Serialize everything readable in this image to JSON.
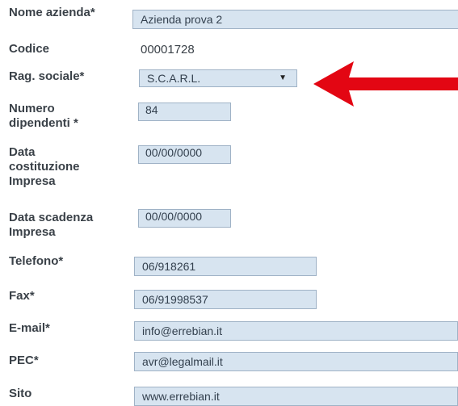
{
  "form": {
    "nome_azienda": {
      "label": "Nome azienda*",
      "value": "Azienda prova 2"
    },
    "codice": {
      "label": "Codice",
      "value": "00001728"
    },
    "rag_sociale": {
      "label": "Rag. sociale*",
      "value": "S.C.A.R.L."
    },
    "numero_dipendenti": {
      "label_line1": "Numero",
      "label_line2": "dipendenti *",
      "value": "84"
    },
    "data_costituzione": {
      "label_line1": "Data",
      "label_line2": "costituzione",
      "label_line3": "Impresa",
      "value": "00/00/0000"
    },
    "data_scadenza": {
      "label_line1": "Data scadenza",
      "label_line2": "Impresa",
      "value": "00/00/0000"
    },
    "telefono": {
      "label": "Telefono*",
      "value": "06/918261"
    },
    "fax": {
      "label": "Fax*",
      "value": "06/91998537"
    },
    "email": {
      "label": "E-mail*",
      "value": "info@errebian.it"
    },
    "pec": {
      "label": "PEC*",
      "value": "avr@legalmail.it"
    },
    "sito": {
      "label": "Sito",
      "value": "www.errebian.it"
    }
  },
  "annotation": {
    "arrow_color": "#e30613",
    "field_bg": "#d7e4f0",
    "field_border": "#9fb2c6"
  }
}
